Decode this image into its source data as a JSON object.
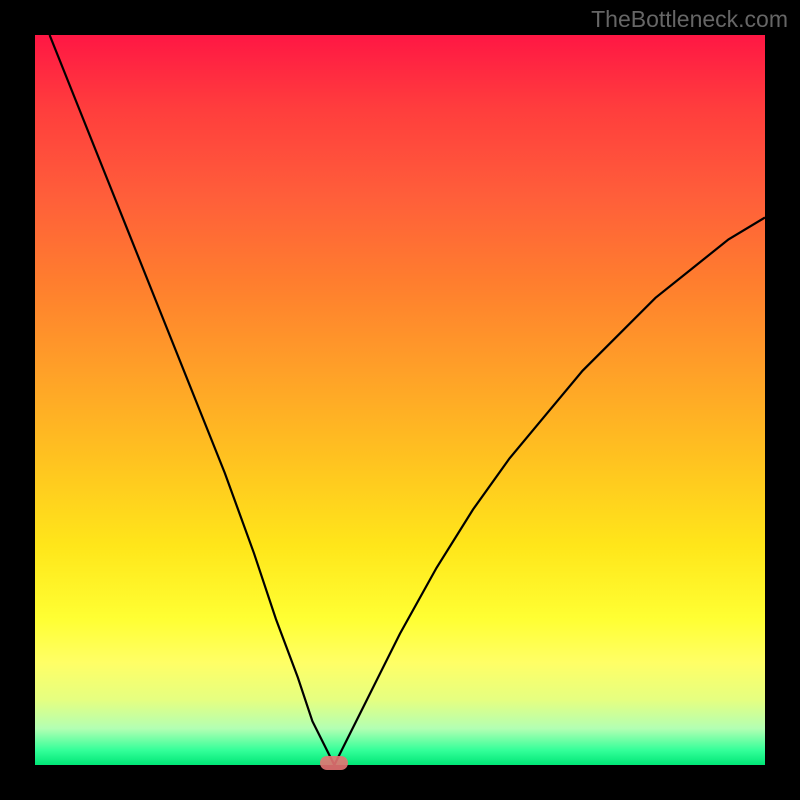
{
  "chart_data": {
    "type": "line",
    "title": "",
    "xlabel": "",
    "ylabel": "",
    "xlim": [
      0,
      100
    ],
    "ylim": [
      0,
      100
    ],
    "grid": false,
    "legend": false,
    "series": [
      {
        "name": "bottleneck-curve",
        "x": [
          2,
          6,
          10,
          14,
          18,
          22,
          26,
          30,
          33,
          36,
          38,
          40,
          41,
          42,
          45,
          50,
          55,
          60,
          65,
          70,
          75,
          80,
          85,
          90,
          95,
          100
        ],
        "y": [
          100,
          90,
          80,
          70,
          60,
          50,
          40,
          29,
          20,
          12,
          6,
          2,
          0,
          2,
          8,
          18,
          27,
          35,
          42,
          48,
          54,
          59,
          64,
          68,
          72,
          75
        ]
      }
    ],
    "markers": [
      {
        "name": "optimal-point",
        "x": 41,
        "y": 0,
        "color": "#e57373"
      }
    ],
    "background_gradient": {
      "type": "vertical",
      "stops": [
        {
          "pos": 0,
          "color": "#ff1744"
        },
        {
          "pos": 50,
          "color": "#ffb020"
        },
        {
          "pos": 80,
          "color": "#ffff33"
        },
        {
          "pos": 100,
          "color": "#00e676"
        }
      ]
    }
  },
  "watermark": "TheBottleneck.com"
}
